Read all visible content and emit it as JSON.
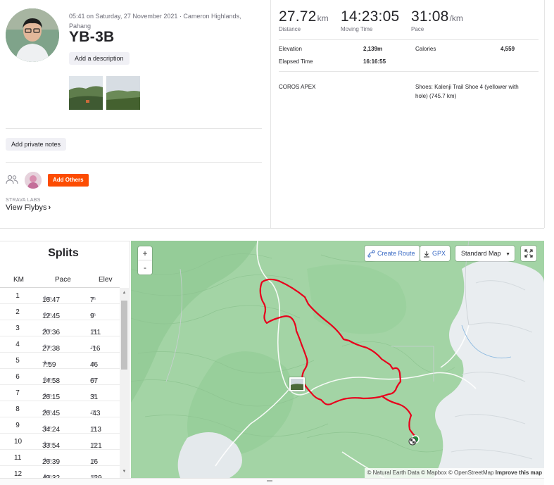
{
  "activity": {
    "meta_line1": "05:41 on Saturday, 27 November 2021 · Cameron Highlands,",
    "meta_line2": "Pahang",
    "title": "YB-3B",
    "add_description": "Add a description",
    "add_private_notes": "Add private notes",
    "add_others": "Add Others",
    "labs_label": "STRAVA LABS",
    "view_flybys": "View Flybys"
  },
  "stats": {
    "distance": {
      "value": "27.72",
      "unit": "km",
      "label": "Distance"
    },
    "moving_time": {
      "value": "14:23:05",
      "label": "Moving Time"
    },
    "pace": {
      "value": "31:08",
      "unit": "/km",
      "label": "Pace"
    },
    "elevation_label": "Elevation",
    "elevation_value": "2,139m",
    "calories_label": "Calories",
    "calories_value": "4,559",
    "elapsed_label": "Elapsed Time",
    "elapsed_value": "16:16:55",
    "device": "COROS APEX",
    "shoes_line1": "Shoes: Kalenji Trail Shoe 4 (yellower with",
    "shoes_line2": "hole) (745.7 km)"
  },
  "splits": {
    "title": "Splits",
    "headers": {
      "km": "KM",
      "pace": "Pace",
      "elev": "Elev"
    },
    "pace_unit": "/km",
    "elev_unit": "m",
    "rows": [
      {
        "km": "1",
        "pace": "16:47",
        "elev": "7"
      },
      {
        "km": "2",
        "pace": "12:45",
        "elev": "9"
      },
      {
        "km": "3",
        "pace": "20:36",
        "elev": "111"
      },
      {
        "km": "4",
        "pace": "27:38",
        "elev": "-16"
      },
      {
        "km": "5",
        "pace": "7:59",
        "elev": "46"
      },
      {
        "km": "6",
        "pace": "14:58",
        "elev": "67"
      },
      {
        "km": "7",
        "pace": "26:15",
        "elev": "31"
      },
      {
        "km": "8",
        "pace": "26:45",
        "elev": "-43"
      },
      {
        "km": "9",
        "pace": "34:24",
        "elev": "113"
      },
      {
        "km": "10",
        "pace": "33:54",
        "elev": "121"
      },
      {
        "km": "11",
        "pace": "26:39",
        "elev": "16"
      },
      {
        "km": "12",
        "pace": "49:32",
        "elev": "129"
      }
    ]
  },
  "map": {
    "zoom_in": "+",
    "zoom_out": "-",
    "create_route": "Create Route",
    "gpx": "GPX",
    "standard_map": "Standard Map",
    "attribution": "© Natural Earth Data © Mapbox © OpenStreetMap",
    "improve": "Improve this map",
    "route_color": "#e8001c"
  },
  "colors": {
    "accent": "#fc4c02",
    "link": "#3b6bc5"
  }
}
